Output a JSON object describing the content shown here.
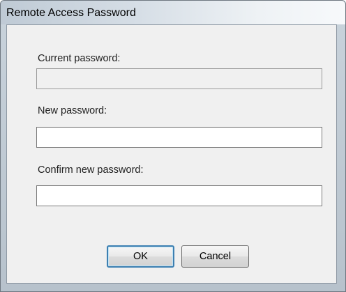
{
  "window": {
    "title": "Remote Access Password"
  },
  "form": {
    "current_password": {
      "label": "Current password:",
      "value": "",
      "enabled": false
    },
    "new_password": {
      "label": "New password:",
      "value": ""
    },
    "confirm_password": {
      "label": "Confirm new password:",
      "value": ""
    }
  },
  "buttons": {
    "ok_label": "OK",
    "cancel_label": "Cancel"
  },
  "colors": {
    "client_background": "#f0f0f0",
    "default_button_border": "#3c7fb1"
  }
}
